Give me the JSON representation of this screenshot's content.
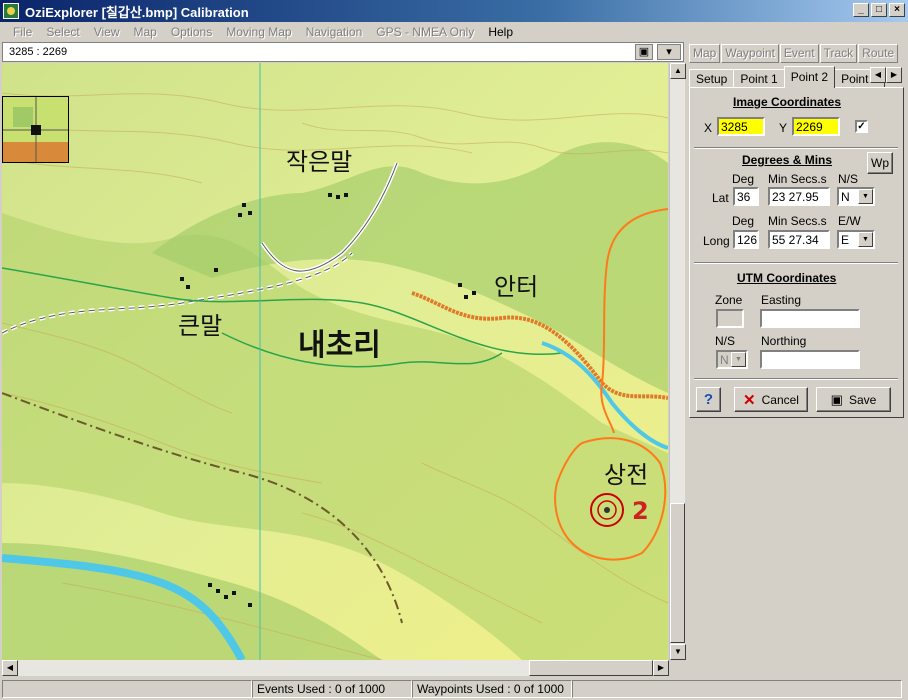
{
  "window": {
    "title": "OziExplorer [칠갑산.bmp] Calibration",
    "minimize": "_",
    "maximize": "□",
    "close": "×"
  },
  "menu": [
    "File",
    "Select",
    "View",
    "Map",
    "Options",
    "Moving Map",
    "Navigation",
    "GPS - NMEA Only",
    "Help"
  ],
  "coord_readout": "3285 : 2269",
  "toolbar_right": [
    "Map",
    "Waypoint",
    "Event",
    "Track",
    "Route"
  ],
  "tabs": [
    "Setup",
    "Point 1",
    "Point 2",
    "Point 3"
  ],
  "active_tab": "Point 2",
  "image_coords": {
    "title": "Image Coordinates",
    "x_label": "X",
    "x_value": "3285",
    "y_label": "Y",
    "y_value": "2269",
    "checked": true
  },
  "degmins": {
    "title": "Degrees & Mins",
    "wp_label": "Wp",
    "lat": {
      "row_label": "Lat",
      "deg_header": "Deg",
      "min_header": "Min Secs.s",
      "hemi_header": "N/S",
      "deg": "36",
      "min": "23 27.95",
      "hemi": "N"
    },
    "long": {
      "row_label": "Long",
      "deg_header": "Deg",
      "min_header": "Min Secs.s",
      "hemi_header": "E/W",
      "deg": "126",
      "min": "55 27.34",
      "hemi": "E"
    }
  },
  "utm": {
    "title": "UTM Coordinates",
    "zone_label": "Zone",
    "easting_label": "Easting",
    "ns_label": "N/S",
    "ns_value": "N",
    "northing_label": "Northing"
  },
  "buttons": {
    "help": "?",
    "cancel": "Cancel",
    "save": "Save"
  },
  "status": {
    "events": "Events Used : 0 of 1000",
    "waypoints": "Waypoints Used : 0 of 1000"
  },
  "map_labels": {
    "jageunmal": "작은말",
    "keunmal": "큰말",
    "anteo": "안터",
    "naechori": "내초리",
    "sangjeon": "상전",
    "point_number": "2"
  },
  "colors": {
    "title_gradient_start": "#0a246a",
    "highlight_field": "#ffff00",
    "annotation": "#ff7a1a",
    "calibration_marker": "#cc0000"
  }
}
